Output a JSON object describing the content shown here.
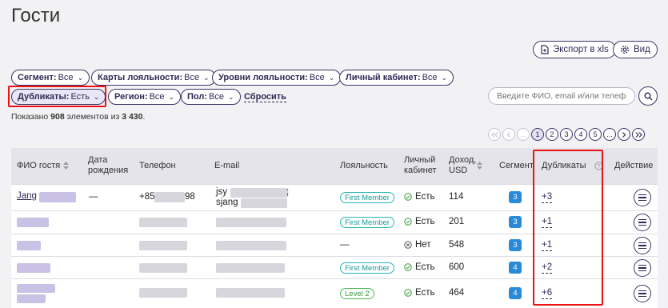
{
  "page": {
    "title": "Гости"
  },
  "toolbar": {
    "export_label": "Экспорт в xls",
    "view_label": "Вид"
  },
  "filters": [
    {
      "label": "Сегмент:",
      "value": "Все"
    },
    {
      "label": "Карты лояльности:",
      "value": "Все"
    },
    {
      "label": "Уровни лояльности:",
      "value": "Все"
    },
    {
      "label": "Личный кабинет:",
      "value": "Все"
    },
    {
      "label": "Дубликаты:",
      "value": "Есть"
    },
    {
      "label": "Регион:",
      "value": "Все"
    },
    {
      "label": "Пол:",
      "value": "Все"
    }
  ],
  "reset_label": "Сбросить",
  "search": {
    "placeholder": "Введите ФИО, email и/или телефон"
  },
  "summary": {
    "prefix": "Показано",
    "shown": "908",
    "middle": "элементов из",
    "total": "3 430",
    "suffix": "."
  },
  "pagination": {
    "pages": [
      "1",
      "2",
      "3",
      "4",
      "5"
    ],
    "current": "1",
    "ellipsis": "..."
  },
  "columns": {
    "name": "ФИО гостя",
    "birth_1": "Дата",
    "birth_2": "рождения",
    "phone": "Телефон",
    "email": "E-mail",
    "loyalty": "Лояльность",
    "cabinet_1": "Личный",
    "cabinet_2": "кабинет",
    "income_1": "Доход,",
    "income_2": "USD",
    "segment": "Сегмент",
    "duplicates": "Дубликаты",
    "action": "Действие"
  },
  "rows": [
    {
      "name": "Jang",
      "birth": "—",
      "phone_start": "+85",
      "phone_end": "98",
      "email_1": "jsy",
      "email_1_end": ";",
      "email_2": "sjang",
      "loyalty": "First Member",
      "cabinet": "Есть",
      "income": "114",
      "segment": "3",
      "duplicates": "+3"
    },
    {
      "name": "",
      "birth": "",
      "phone_start": "",
      "phone_end": "",
      "email_1": "",
      "email_1_end": "",
      "email_2": "",
      "loyalty": "First Member",
      "cabinet": "Есть",
      "income": "201",
      "segment": "3",
      "duplicates": "+1"
    },
    {
      "name": "",
      "birth": "",
      "phone_start": "",
      "phone_end": "",
      "email_1": "",
      "email_1_end": "",
      "email_2": "",
      "loyalty": "—",
      "cabinet": "Нет",
      "income": "548",
      "segment": "3",
      "duplicates": "+1"
    },
    {
      "name": "",
      "birth": "",
      "phone_start": "",
      "phone_end": "",
      "email_1": "",
      "email_1_end": "",
      "email_2": "",
      "loyalty": "First Member",
      "cabinet": "Есть",
      "income": "600",
      "segment": "4",
      "duplicates": "+2"
    },
    {
      "name": "",
      "birth": "",
      "phone_start": "",
      "phone_end": "",
      "email_1": "",
      "email_1_end": "",
      "email_2": "",
      "loyalty": "Level 2",
      "cabinet": "Есть",
      "income": "464",
      "segment": "4",
      "duplicates": "+6"
    }
  ],
  "colors": {
    "accent": "#3d3366",
    "highlight": "#ee1111",
    "segment": "#2a8ad8",
    "teal_badge": "#27b5b5",
    "green_badge": "#4db84d"
  }
}
